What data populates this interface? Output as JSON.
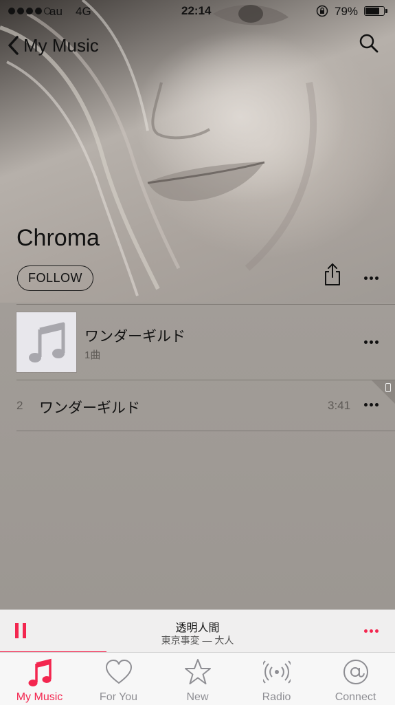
{
  "status_bar": {
    "carrier": "au",
    "network": "4G",
    "time": "22:14",
    "battery_percent": "79%",
    "battery_level": 0.79
  },
  "nav": {
    "back_label": "My Music",
    "back_icon": "chevron-left-icon",
    "search_icon": "search-icon"
  },
  "artist": {
    "name": "Chroma",
    "follow_label": "FOLLOW"
  },
  "album": {
    "title": "ワンダーギルド",
    "subtitle": "1曲",
    "artwork_icon": "music-note-icon"
  },
  "tracks": [
    {
      "number": "2",
      "title": "ワンダーギルド",
      "duration": "3:41"
    }
  ],
  "now_playing": {
    "title": "透明人間",
    "subtitle": "東京事変 — 大人",
    "progress": 0.27
  },
  "tabs": [
    {
      "label": "My Music",
      "icon": "music-note-icon",
      "active": true
    },
    {
      "label": "For You",
      "icon": "heart-icon",
      "active": false
    },
    {
      "label": "New",
      "icon": "star-icon",
      "active": false
    },
    {
      "label": "Radio",
      "icon": "radio-broadcast-icon",
      "active": false
    },
    {
      "label": "Connect",
      "icon": "at-sign-icon",
      "active": false
    }
  ],
  "colors": {
    "accent": "#f3264f",
    "background": "#9f9a95",
    "tab_inactive": "#8e8e93"
  }
}
